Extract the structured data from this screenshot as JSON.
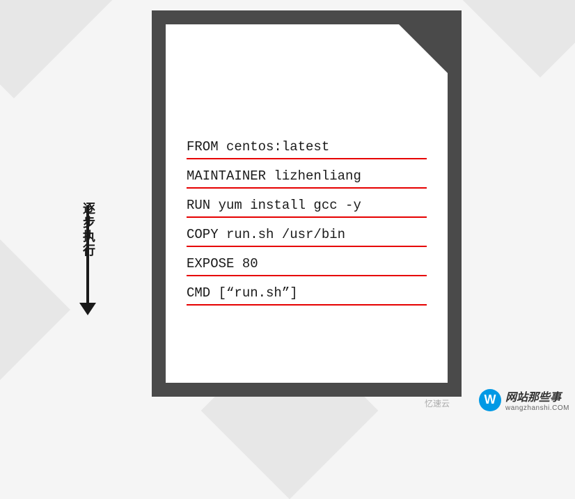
{
  "dockerfile": {
    "lines": [
      "FROM centos:latest",
      "MAINTAINER lizhenliang",
      "RUN yum install gcc -y",
      "COPY run.sh /usr/bin",
      "EXPOSE 80",
      "CMD [“run.sh”]"
    ]
  },
  "arrow": {
    "label": "逐步执行"
  },
  "watermark": {
    "icon_letter": "W",
    "title": "网站那些事",
    "url": "wangzhanshi.COM"
  },
  "credit": "忆速云"
}
